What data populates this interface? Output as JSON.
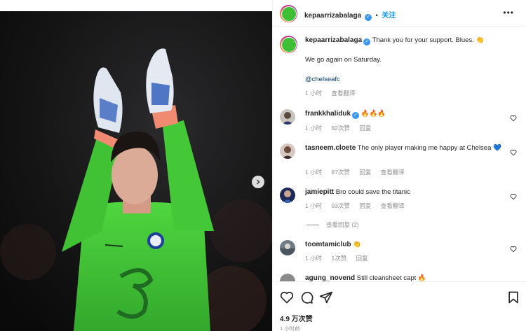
{
  "post": {
    "username": "kepaarrizabalaga",
    "follow_separator": "•",
    "follow_label": "关注",
    "caption": {
      "line1": "Thank you for your support. Blues.",
      "line1_emoji": "👏",
      "line2": "We go again on Saturday.",
      "mention": "@chelseafc",
      "time": "1 小时",
      "translate": "查看翻译"
    }
  },
  "comments": [
    {
      "username": "frankkhaliduk",
      "verified": true,
      "text": "🔥🔥🔥",
      "time": "1 小时",
      "likes": "82次赞",
      "reply": "回复",
      "translate": ""
    },
    {
      "username": "tasneem.cloete",
      "verified": false,
      "text": "The only player making me happy at Chelsea 💙",
      "time": "1 小时",
      "likes": "87次赞",
      "reply": "回复",
      "translate": "查看翻译"
    },
    {
      "username": "jamiepitt",
      "verified": false,
      "text": "Bro could save the titanic",
      "time": "1 小时",
      "likes": "93次赞",
      "reply": "回复",
      "translate": "查看翻译"
    },
    {
      "username": "toomtamiclub",
      "verified": false,
      "text": "👏",
      "time": "1 小时",
      "likes": "1次赞",
      "reply": "回复",
      "translate": ""
    },
    {
      "username": "agung_novend",
      "verified": false,
      "text": "Still cleansheet capt 🔥",
      "time": "",
      "likes": "",
      "reply": "",
      "translate": ""
    }
  ],
  "view_replies": "查看回复 (2)",
  "footer": {
    "likes": "4.9 万次赞",
    "time": "1 小时前"
  },
  "icons": {
    "next": "chevron-right-icon",
    "like": "heart-icon",
    "comment": "comment-icon",
    "share": "paper-plane-icon",
    "save": "bookmark-icon",
    "more": "more-options-icon"
  },
  "colors": {
    "accent": "#0095f6",
    "verified": "#3897f0",
    "kit": "#46c93a"
  }
}
